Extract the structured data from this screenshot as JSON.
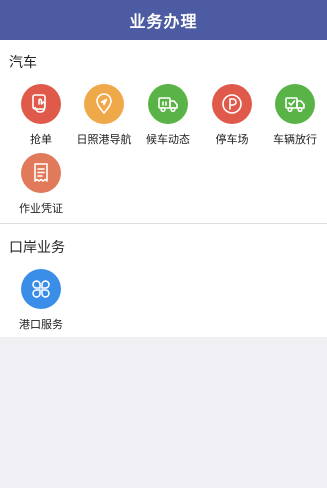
{
  "header": {
    "title": "业务办理",
    "color": "#4c5ba2"
  },
  "sections": [
    {
      "title": "汽车",
      "items": [
        {
          "label": "抢单",
          "icon": "hand-tap-icon",
          "color": "#e05a4c"
        },
        {
          "label": "日照港导航",
          "icon": "location-pin-icon",
          "color": "#efa94a"
        },
        {
          "label": "候车动态",
          "icon": "truck-icon",
          "color": "#5ab347"
        },
        {
          "label": "停车场",
          "icon": "parking-icon",
          "color": "#e05a4c"
        },
        {
          "label": "车辆放行",
          "icon": "truck-release-icon",
          "color": "#5ab347"
        },
        {
          "label": "作业凭证",
          "icon": "receipt-icon",
          "color": "#e07a5a"
        }
      ]
    },
    {
      "title": "口岸业务",
      "items": [
        {
          "label": "港口服务",
          "icon": "clover-grid-icon",
          "color": "#3b8ee8"
        }
      ]
    }
  ]
}
